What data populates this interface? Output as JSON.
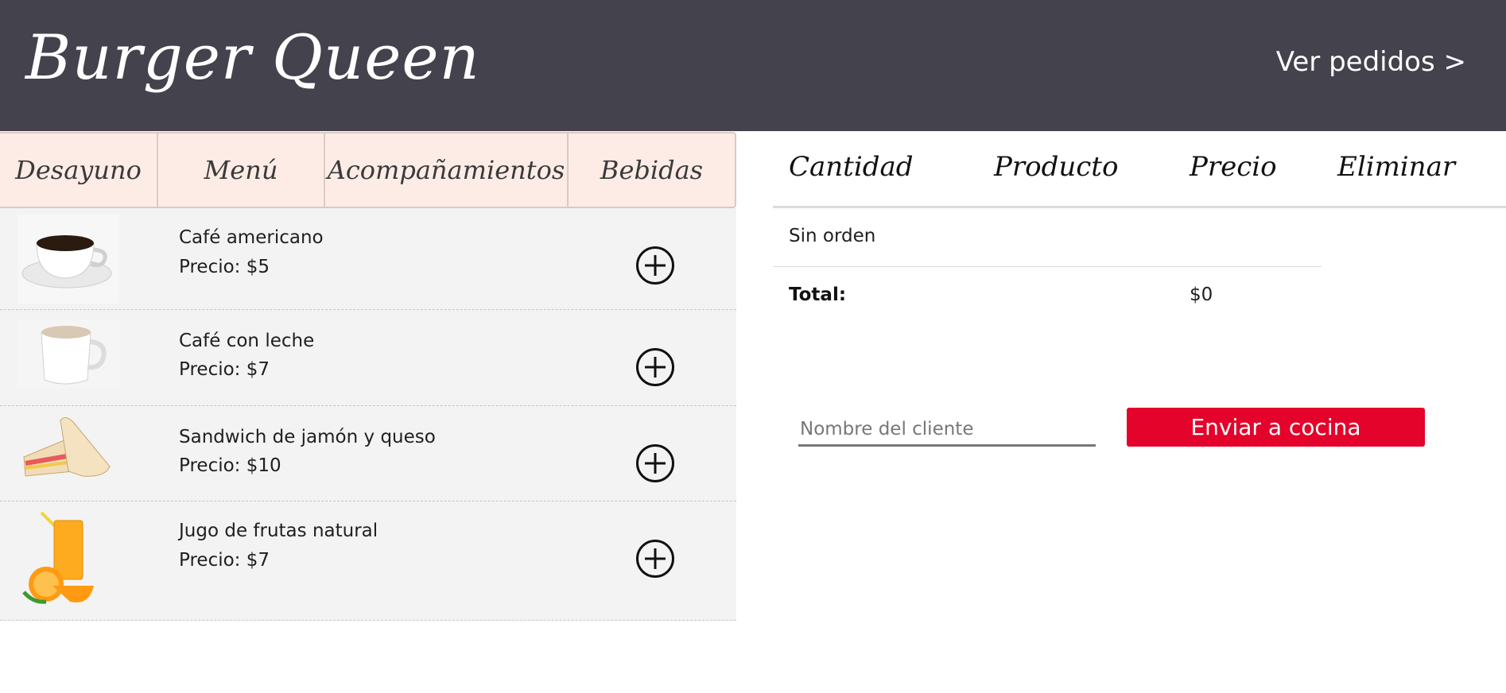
{
  "header": {
    "brand": "Burger Queen",
    "orders_link": "Ver pedidos >"
  },
  "menu_tabs": [
    "Desayuno",
    "Menú",
    "Acompañamientos",
    "Bebidas"
  ],
  "products": [
    {
      "name": "Café americano",
      "price": "Precio: $5",
      "image": "coffee-cup-icon"
    },
    {
      "name": "Café con leche",
      "price": "Precio: $7",
      "image": "latte-mug-icon"
    },
    {
      "name": "Sandwich de jamón y queso",
      "price": "Precio: $10",
      "image": "sandwich-icon"
    },
    {
      "name": "Jugo de frutas natural",
      "price": "Precio: $7",
      "image": "orange-juice-icon"
    }
  ],
  "order": {
    "columns": [
      "Cantidad",
      "Producto",
      "Precio",
      "Eliminar"
    ],
    "empty_text": "Sin orden",
    "total_label": "Total:",
    "total_value": "$0"
  },
  "form": {
    "client_placeholder": "Nombre del cliente",
    "send_label": "Enviar a cocina"
  },
  "colors": {
    "header_bg": "#43424d",
    "tab_bg": "#fdece6",
    "list_bg": "#f3f3f3",
    "send_button": "#e4032a"
  }
}
